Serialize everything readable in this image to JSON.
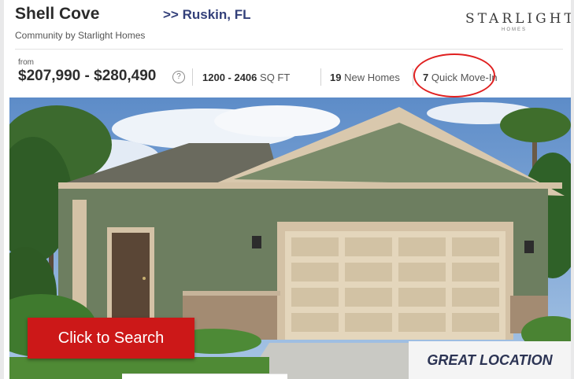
{
  "listing": {
    "title": "Shell Cove",
    "location_link": ">> Ruskin, FL",
    "subtitle": "Community by Starlight Homes"
  },
  "brand": {
    "logo_main": "STARLIGHT",
    "logo_sub": "HOMES"
  },
  "pricing": {
    "from_label": "from",
    "range": "$207,990 - $280,490",
    "help_icon": "?"
  },
  "stats": {
    "sqft_range": "1200 - 2406",
    "sqft_unit": "SQ FT",
    "new_homes_count": "19",
    "new_homes_label": "New Homes",
    "quick_movein_count": "7",
    "quick_movein_label": "Quick Move-In"
  },
  "cta": {
    "label": "Click to Search"
  },
  "badge": {
    "label": "GREAT LOCATION"
  },
  "colors": {
    "cta_background": "#cc1818",
    "annotation_oval": "#e02020",
    "location_link": "#33407a"
  }
}
